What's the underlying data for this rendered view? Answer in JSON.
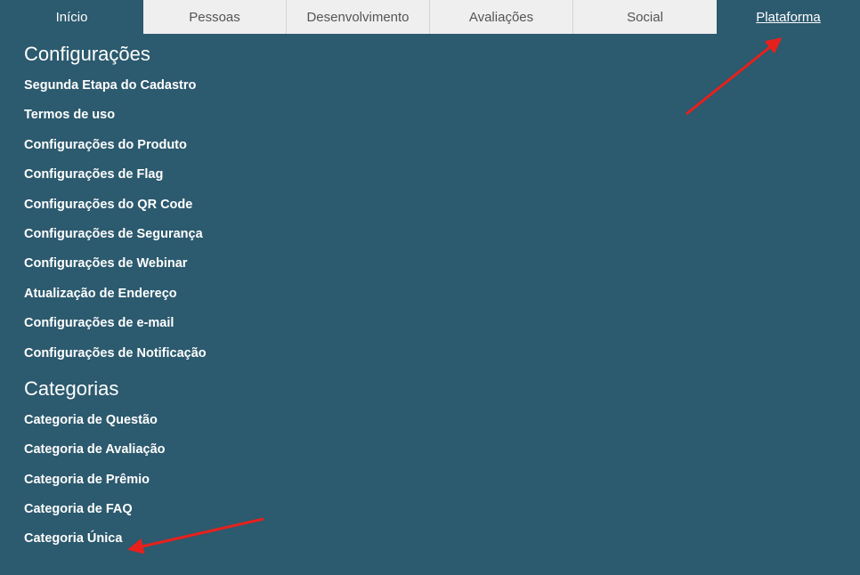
{
  "nav": {
    "tabs": [
      {
        "label": "Início",
        "style": "dark"
      },
      {
        "label": "Pessoas",
        "style": "light"
      },
      {
        "label": "Desenvolvimento",
        "style": "light"
      },
      {
        "label": "Avaliações",
        "style": "light"
      },
      {
        "label": "Social",
        "style": "light"
      },
      {
        "label": "Plataforma",
        "style": "dark",
        "active": true
      }
    ]
  },
  "sections": {
    "configuracoes": {
      "title": "Configurações",
      "items": [
        "Segunda Etapa do Cadastro",
        "Termos de uso",
        "Configurações do Produto",
        "Configurações de Flag",
        "Configurações do QR Code",
        "Configurações de Segurança",
        "Configurações de Webinar",
        "Atualização de Endereço",
        "Configurações de e-mail",
        "Configurações de Notificação"
      ]
    },
    "categorias": {
      "title": "Categorias",
      "items": [
        "Categoria de Questão",
        "Categoria de Avaliação",
        "Categoria de Prêmio",
        "Categoria de FAQ",
        "Categoria Única"
      ]
    }
  },
  "colors": {
    "background": "#2c5a6e",
    "tab_light": "#efefef",
    "annotation_arrow": "#e8201c"
  }
}
